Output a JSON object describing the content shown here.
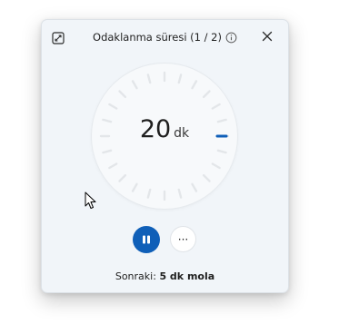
{
  "window": {
    "title": "Odaklanma süresi (1 / 2)",
    "icons": {
      "expand": "expand-icon",
      "info": "info-icon",
      "close": "close-icon",
      "pause": "pause-icon",
      "more": "more-icon"
    }
  },
  "timer": {
    "value": "20",
    "unit": "dk",
    "progress_fraction": 0.0
  },
  "controls": {
    "more_label": "···"
  },
  "footer": {
    "next_prefix": "Sonraki:",
    "next_value": "5 dk mola"
  },
  "colors": {
    "accent": "#0f5fb8",
    "tick": "#e3e6e9",
    "background": "#f1f5f9"
  }
}
